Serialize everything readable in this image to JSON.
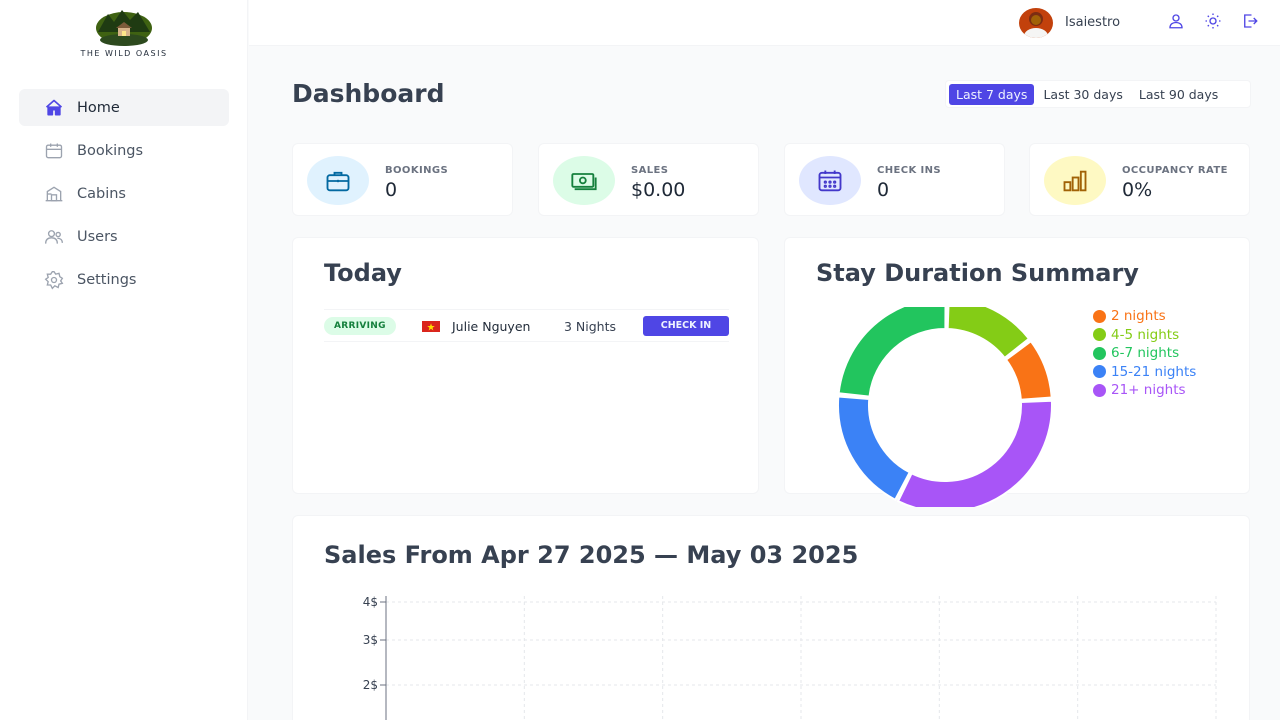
{
  "brand": {
    "name": "THE WILD OASIS"
  },
  "sidebar": {
    "items": [
      {
        "label": "Home",
        "icon": "home-icon",
        "active": true
      },
      {
        "label": "Bookings",
        "icon": "calendar-icon",
        "active": false
      },
      {
        "label": "Cabins",
        "icon": "cabin-icon",
        "active": false
      },
      {
        "label": "Users",
        "icon": "users-icon",
        "active": false
      },
      {
        "label": "Settings",
        "icon": "settings-icon",
        "active": false
      }
    ]
  },
  "header": {
    "username": "Isaiestro",
    "actions": [
      "user-icon",
      "sun-icon",
      "logout-icon"
    ]
  },
  "main": {
    "title": "Dashboard",
    "filters": [
      {
        "label": "Last 7 days",
        "active": true
      },
      {
        "label": "Last 30 days",
        "active": false
      },
      {
        "label": "Last 90 days",
        "active": false
      }
    ],
    "stats": [
      {
        "label": "BOOKINGS",
        "value": "0",
        "icon": "briefcase-icon",
        "bg": "#e0f2fe",
        "color": "#0369a1"
      },
      {
        "label": "SALES",
        "value": "$0.00",
        "icon": "banknotes-icon",
        "bg": "#dcfce7",
        "color": "#15803d"
      },
      {
        "label": "CHECK INS",
        "value": "0",
        "icon": "calendar-days-icon",
        "bg": "#e0e7ff",
        "color": "#4338ca"
      },
      {
        "label": "OCCUPANCY RATE",
        "value": "0%",
        "icon": "chart-bar-icon",
        "bg": "#fef9c3",
        "color": "#a16207"
      }
    ],
    "today": {
      "title": "Today",
      "activities": [
        {
          "status": "ARRIVING",
          "flag": "vietnam-flag",
          "guest": "Julie Nguyen",
          "nights": "3 Nights",
          "action": "CHECK IN"
        }
      ]
    },
    "duration": {
      "title": "Stay Duration Summary"
    },
    "sales": {
      "title": "Sales From Apr 27 2025 — May 03 2025"
    }
  },
  "colors": {
    "accent": "#4f46e5"
  },
  "chart_data": [
    {
      "type": "pie",
      "title": "Stay Duration Summary",
      "categories": [
        "2 nights",
        "4-5 nights",
        "6-7 nights",
        "15-21 nights",
        "21+ nights"
      ],
      "values": [
        2,
        3,
        5,
        4,
        7
      ],
      "colors": [
        "#f97316",
        "#84cc16",
        "#22c55e",
        "#3b82f6",
        "#a855f7"
      ],
      "legend": "top-right",
      "donut": true
    },
    {
      "type": "area",
      "title": "Sales From Apr 27 2025 — May 03 2025",
      "yticks": [
        "4$",
        "3$",
        "2$"
      ],
      "ylim": [
        0,
        4
      ],
      "grid": true
    }
  ]
}
